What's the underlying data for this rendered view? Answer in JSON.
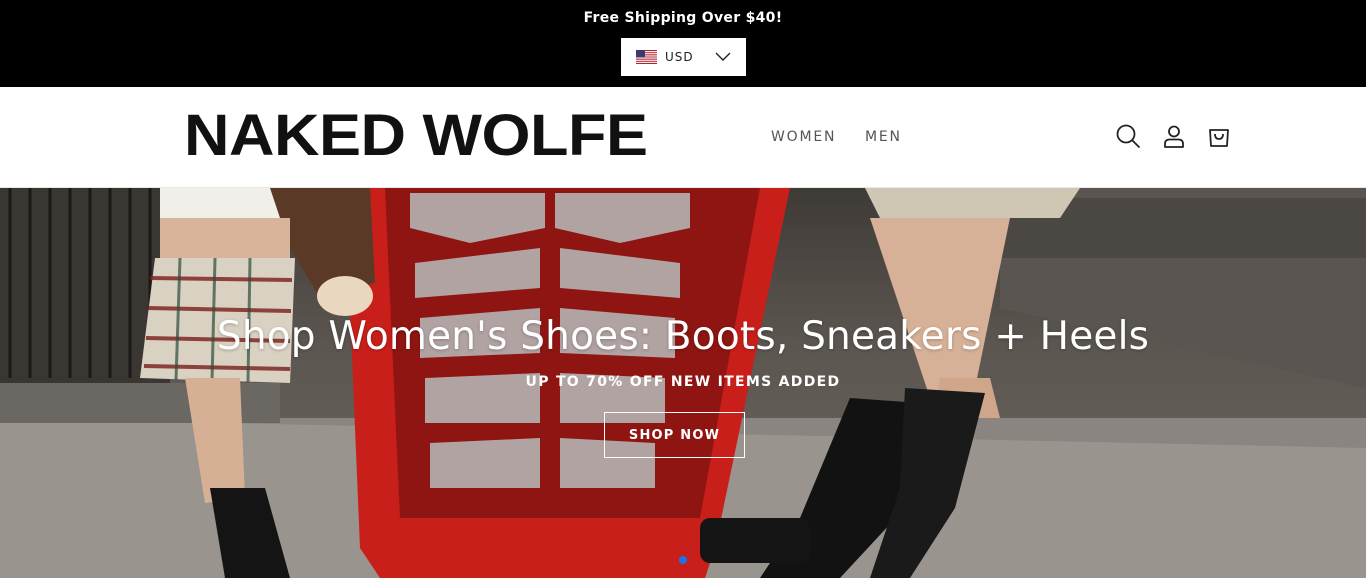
{
  "announcement": {
    "text": "Free Shipping Over $40!"
  },
  "currency": {
    "label": "USD",
    "flag": "us-flag-icon"
  },
  "header": {
    "logo": "NAKED WOLFE",
    "nav": [
      {
        "label": "WOMEN"
      },
      {
        "label": "MEN"
      }
    ],
    "icons": [
      "search-icon",
      "account-icon",
      "cart-icon"
    ]
  },
  "hero": {
    "title": "Shop Women's Shoes: Boots, Sneakers + Heels",
    "subtitle": "UP TO 70% OFF NEW ITEMS ADDED",
    "cta": "SHOP NOW",
    "active_dot_color": "#1a73e8"
  },
  "colors": {
    "announce_bg": "#000000",
    "phone_booth_red": "#d4201b"
  }
}
